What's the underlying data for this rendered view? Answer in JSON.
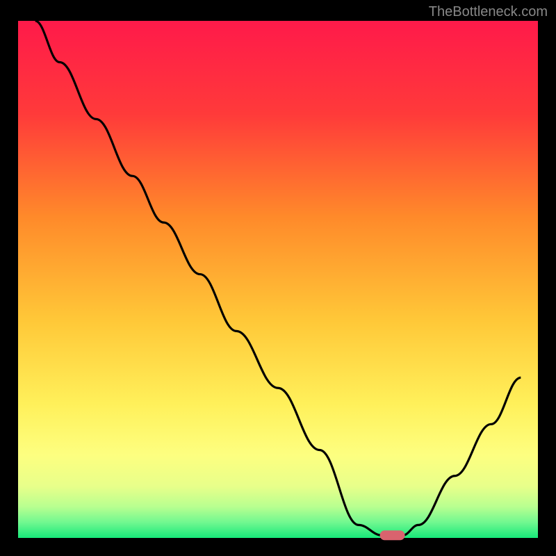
{
  "watermark": "TheBottleneck.com",
  "chart_data": {
    "type": "line",
    "title": "",
    "xlabel": "",
    "ylabel": "",
    "x": [
      0.033,
      0.08,
      0.15,
      0.22,
      0.28,
      0.35,
      0.42,
      0.5,
      0.58,
      0.655,
      0.7,
      0.74,
      0.77,
      0.84,
      0.91,
      0.967
    ],
    "values": [
      1.0,
      0.92,
      0.81,
      0.7,
      0.61,
      0.51,
      0.4,
      0.29,
      0.17,
      0.025,
      0.005,
      0.005,
      0.025,
      0.12,
      0.22,
      0.31
    ],
    "xlim": [
      0,
      1
    ],
    "ylim": [
      0,
      1
    ],
    "marker": {
      "x": 0.72,
      "y": 0.005,
      "color": "#d9636e"
    },
    "background_gradient": {
      "top": "#ff1a4a",
      "mid1": "#ff7a2a",
      "mid2": "#ffd23a",
      "mid3": "#fff970",
      "mid4": "#dfff8a",
      "bottom": "#17e87a"
    }
  }
}
